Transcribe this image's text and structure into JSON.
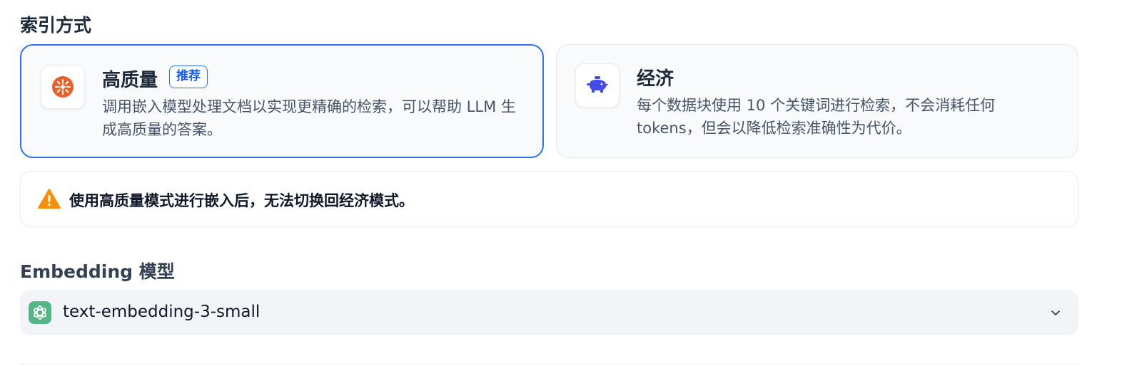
{
  "index_section": {
    "title": "索引方式",
    "high_quality": {
      "title": "高质量",
      "badge": "推荐",
      "description": "调用嵌入模型处理文档以实现更精确的检索，可以帮助 LLM 生成高质量的答案。",
      "icon": "sparkle-burst-icon",
      "selected": true
    },
    "economy": {
      "title": "经济",
      "description": "每个数据块使用 10 个关键词进行检索，不会消耗任何 tokens，但会以降低检索准确性为代价。",
      "icon": "piggy-bank-icon",
      "selected": false
    },
    "warning": {
      "icon": "warning-triangle-icon",
      "text": "使用高质量模式进行嵌入后，无法切换回经济模式。"
    }
  },
  "embedding_section": {
    "label": "Embedding 模型",
    "selected_model": "text-embedding-3-small",
    "model_icon": "openai-icon"
  },
  "colors": {
    "accent": "#2970ff",
    "high_quality_icon": "#e8602c",
    "economy_icon": "#444ce7",
    "warning_icon": "#f79009",
    "model_icon_bg": "#54b585"
  }
}
